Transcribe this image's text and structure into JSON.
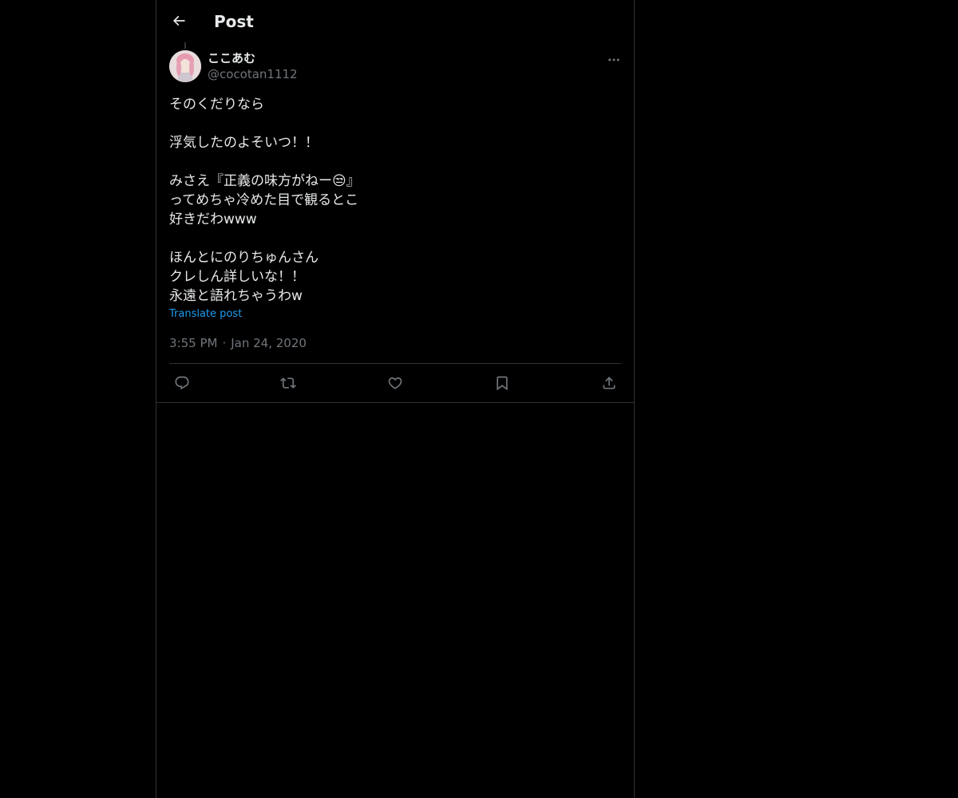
{
  "header": {
    "title": "Post",
    "back_icon": "arrow-left-icon"
  },
  "tweet": {
    "author": {
      "display_name": "ここあむ",
      "handle": "@cocotan1112"
    },
    "more_icon": "more-horizontal-icon",
    "text": "そのくだりなら\n\n浮気したのよそいつ！！\n\nみさえ『正義の味方がねー😒』\nってめちゃ冷めた目で観るとこ\n好きだわwww\n\nほんとにのりちゅんさん\nクレしん詳しいな！！\n永遠と語れちゃうわw",
    "translate_label": "Translate post",
    "time": "3:55 PM",
    "separator": "·",
    "date": "Jan 24, 2020",
    "actions": [
      {
        "icon": "reply-icon"
      },
      {
        "icon": "repost-icon"
      },
      {
        "icon": "like-icon"
      },
      {
        "icon": "bookmark-icon"
      },
      {
        "icon": "share-icon"
      }
    ]
  },
  "colors": {
    "background": "#000000",
    "text": "#e7e9ea",
    "secondary_text": "#71767b",
    "link": "#1d9bf0",
    "border": "#2f3336"
  }
}
